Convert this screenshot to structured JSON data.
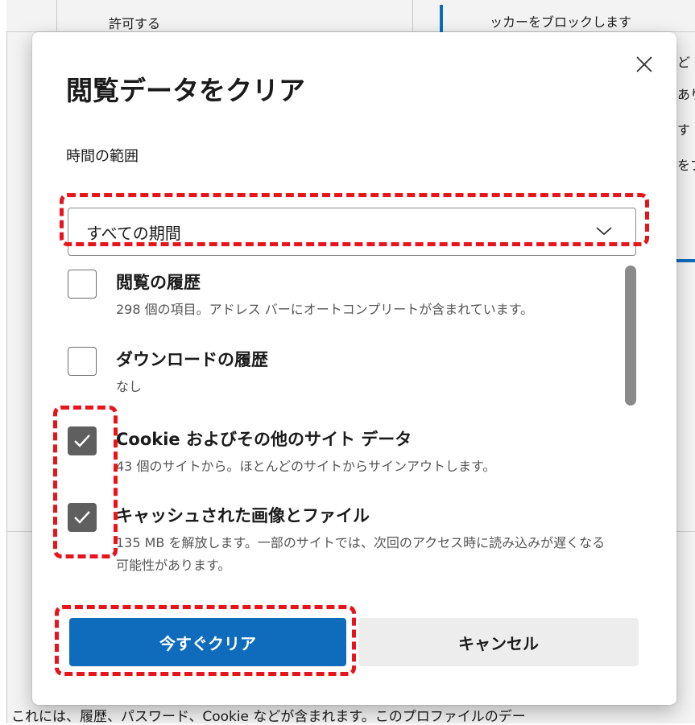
{
  "background": {
    "top_left_text": "許可する",
    "top_right_text": "ッカーをブロックします",
    "right_fragments": [
      "ど",
      "あり",
      "す",
      "をブ"
    ],
    "bottom_text": "これには、履歴、パスワード、Cookie などが含まれます。このプロファイルのデー"
  },
  "dialog": {
    "title": "閲覧データをクリア",
    "close_icon": "close-icon",
    "time_range": {
      "label": "時間の範囲",
      "selected": "すべての期間"
    },
    "options": [
      {
        "title": "閲覧の履歴",
        "description": "298 個の項目。アドレス バーにオートコンプリートが含まれています。",
        "checked": false
      },
      {
        "title": "ダウンロードの履歴",
        "description": "なし",
        "checked": false
      },
      {
        "title": "Cookie およびその他のサイト データ",
        "description": "43 個のサイトから。ほとんどのサイトからサインアウトします。",
        "checked": true
      },
      {
        "title": "キャッシュされた画像とファイル",
        "description": "135 MB を解放します。一部のサイトでは、次回のアクセス時に読み込みが遅くなる可能性があります。",
        "checked": true
      }
    ],
    "buttons": {
      "clear_now": "今すぐクリア",
      "cancel": "キャンセル"
    }
  },
  "colors": {
    "primary": "#0f6cbd",
    "annotation": "#e8141b",
    "checkbox_checked": "#5f5f5f"
  }
}
